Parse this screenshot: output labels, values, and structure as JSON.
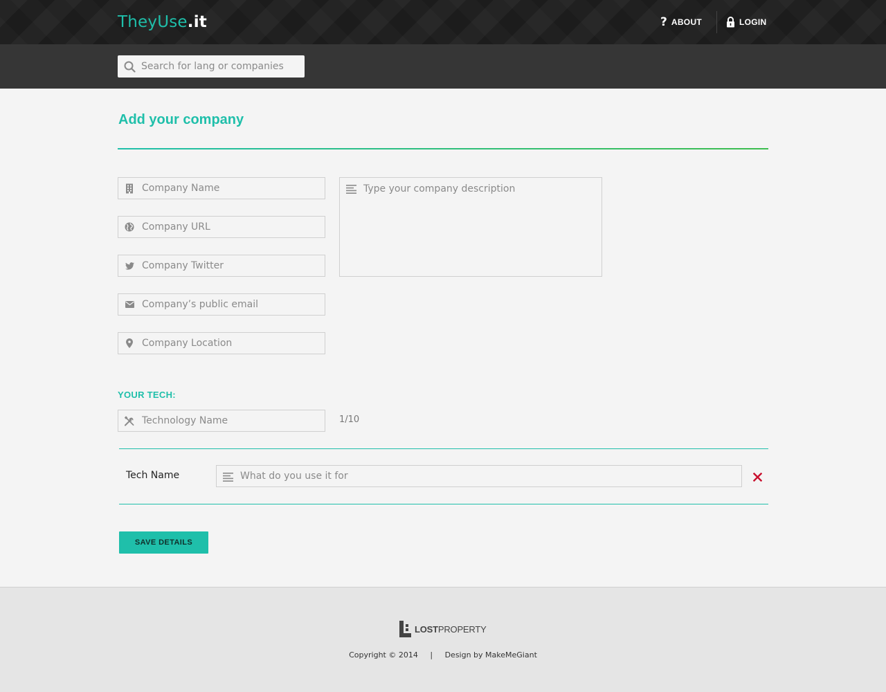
{
  "header": {
    "logo_main": "TheyUse",
    "logo_suffix": ".it",
    "nav": {
      "about_label": "ABOUT",
      "login_label": "LOGIN"
    },
    "search": {
      "placeholder": "Search for lang or companies",
      "value": ""
    }
  },
  "main": {
    "title": "Add your company",
    "fields": {
      "company_name": {
        "placeholder": "Company Name",
        "icon": "building-icon"
      },
      "company_url": {
        "placeholder": "Company URL",
        "icon": "globe-icon"
      },
      "company_twitter": {
        "placeholder": "Company Twitter",
        "icon": "twitter-icon"
      },
      "company_email": {
        "placeholder": "Company’s public email",
        "icon": "envelope-icon"
      },
      "company_location": {
        "placeholder": "Company Location",
        "icon": "map-pin-icon"
      },
      "company_description": {
        "placeholder": "Type your company description",
        "icon": "align-left-icon"
      }
    },
    "tech": {
      "heading": "YOUR TECH:",
      "name_placeholder": "Technology Name",
      "name_icon": "tools-icon",
      "count": "1/10",
      "rows": [
        {
          "name": "Tech Name",
          "use_placeholder": "What do you use it for",
          "icon": "align-left-icon"
        }
      ]
    },
    "save_label": "SAVE DETAILS"
  },
  "footer": {
    "logo_bold": "LOST",
    "logo_light": "PROPERTY",
    "copyright": "Copyright © 2014",
    "separator": "|",
    "credit": "Design by MakeMeGiant"
  },
  "colors": {
    "accent": "#1fbfaa",
    "header_bg": "#1c1c1c",
    "search_band_bg": "#363636",
    "remove": "#c8102e"
  }
}
